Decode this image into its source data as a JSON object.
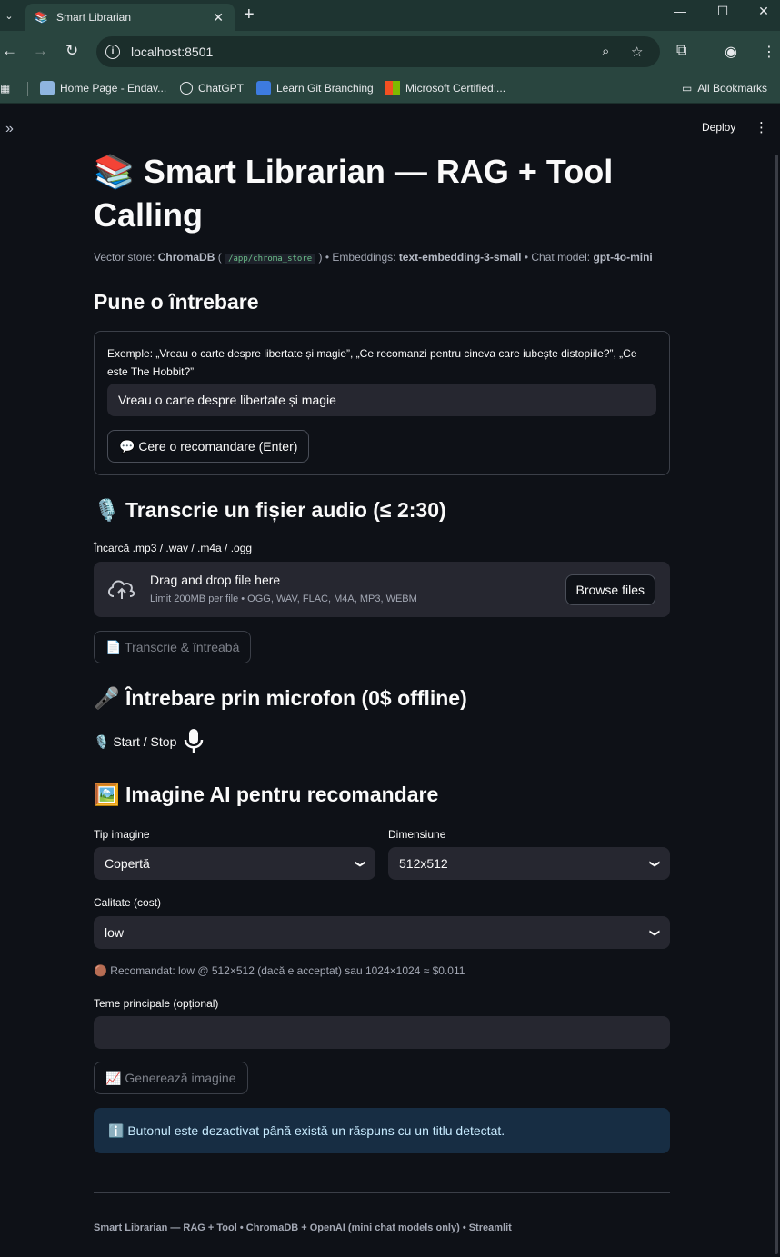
{
  "browser": {
    "tab_title": "Smart Librarian",
    "url": "localhost:8501",
    "bookmarks": [
      "Home Page - Endav...",
      "ChatGPT",
      "Learn Git Branching",
      "Microsoft Certified:...",
      "All Bookmarks"
    ]
  },
  "app": {
    "deploy_label": "Deploy",
    "title": "📚 Smart Librarian — RAG + Tool Calling",
    "caption": {
      "vector_store_label": "Vector store:",
      "vector_store": "ChromaDB",
      "path": "/app/chroma_store",
      "embeddings_label": "• Embeddings:",
      "embeddings": "text-embedding-3-small",
      "chat_model_label": "• Chat model:",
      "chat_model": "gpt-4o-mini"
    },
    "ask": {
      "heading": "Pune o întrebare",
      "examples": "Exemple: „Vreau o carte despre libertate și magie”, „Ce recomanzi pentru cineva care iubește distopiile?”, „Ce este The Hobbit?”",
      "input_value": "Vreau o carte despre libertate și magie",
      "submit": "💬 Cere o recomandare (Enter)"
    },
    "audio": {
      "heading": "🎙️ Transcrie un fișier audio (≤ 2:30)",
      "upload_label": "Încarcă .mp3 / .wav / .m4a / .ogg",
      "drop_text": "Drag and drop file here",
      "limit_text": "Limit 200MB per file • OGG, WAV, FLAC, M4A, MP3, WEBM",
      "browse": "Browse files",
      "transcribe": "📄 Transcrie & întreabă"
    },
    "mic": {
      "heading": "🎤 Întrebare prin microfon (0$ offline)",
      "start_stop": "🎙️ Start / Stop"
    },
    "image": {
      "heading": "🖼️ Imagine AI pentru recomandare",
      "type_label": "Tip imagine",
      "type_value": "Copertă",
      "size_label": "Dimensiune",
      "size_value": "512x512",
      "quality_label": "Calitate (cost)",
      "quality_value": "low",
      "recommend": "🟤 Recomandat: low @ 512×512 (dacă e acceptat) sau 1024×1024 ≈ $0.011",
      "themes_label": "Teme principale (opțional)",
      "themes_value": "",
      "generate": "📈 Generează imagine",
      "info": "ℹ️ Butonul este dezactivat până există un răspuns cu un titlu detectat."
    },
    "footer": "Smart Librarian — RAG + Tool • ChromaDB + OpenAI (mini chat models only) • Streamlit"
  }
}
